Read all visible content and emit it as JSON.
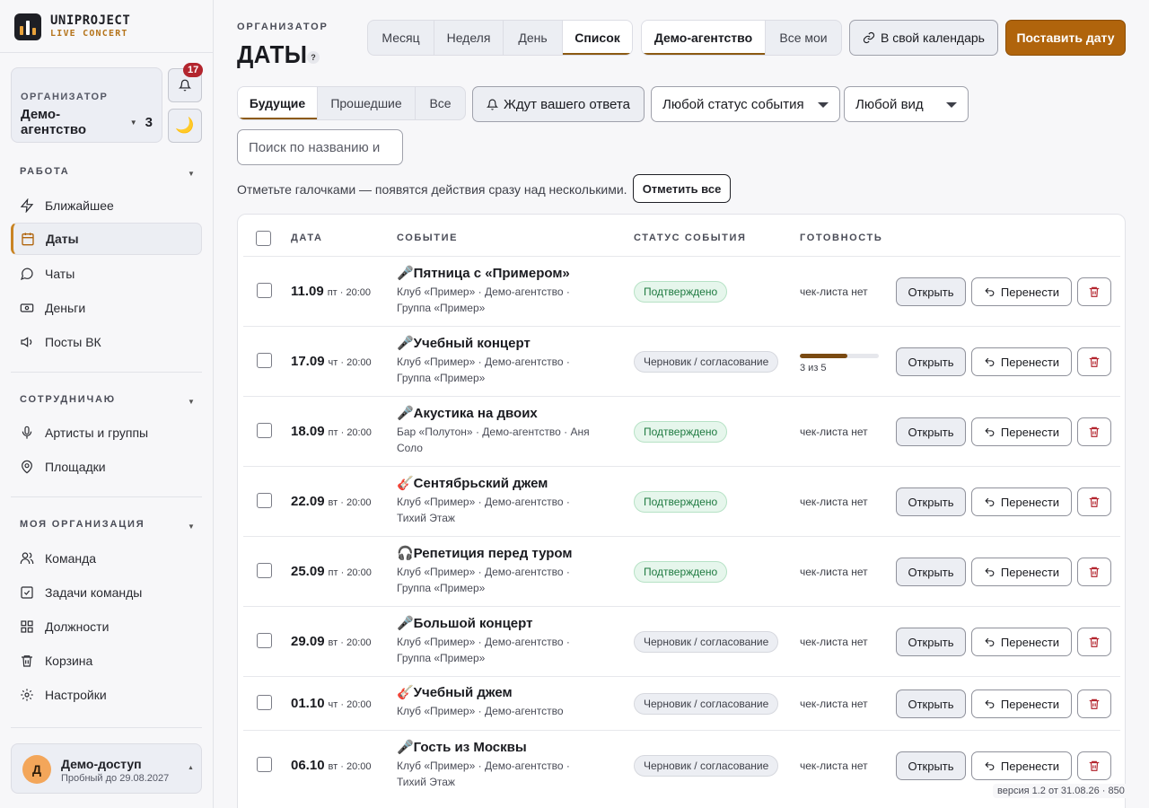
{
  "brand": {
    "name": "UNIPROJECT",
    "sub": "LIVE CONCERT"
  },
  "org": {
    "label": "ОРГАНИЗАТОР",
    "name": "Демо-агентство",
    "count": "3"
  },
  "notifications": {
    "count": "17"
  },
  "sections": {
    "work": "РАБОТА",
    "collab": "СОТРУДНИЧАЮ",
    "myorg": "МОЯ ОРГАНИЗАЦИЯ"
  },
  "nav": {
    "nearest": "Ближайшее",
    "dates": "Даты",
    "chats": "Чаты",
    "money": "Деньги",
    "vk": "Посты ВК",
    "artists": "Артисты и группы",
    "venues": "Площадки",
    "team": "Команда",
    "tasks": "Задачи команды",
    "roles": "Должности",
    "trash": "Корзина",
    "settings": "Настройки"
  },
  "user": {
    "initial": "Д",
    "name": "Демо-доступ",
    "sub": "Пробный до 29.08.2027"
  },
  "page": {
    "pre": "ОРГАНИЗАТОР",
    "title": "ДАТЫ",
    "help": "?"
  },
  "views": [
    "Месяц",
    "Неделя",
    "День",
    "Список"
  ],
  "scope": [
    "Демо-агентство",
    "Все мои"
  ],
  "actions": {
    "calendar": "В свой календарь",
    "add": "Поставить дату"
  },
  "timeframe": [
    "Будущие",
    "Прошедшие",
    "Все"
  ],
  "awaiting": "Ждут вашего ответа",
  "filters": {
    "status": "Любой статус события",
    "kind": "Любой вид"
  },
  "search": {
    "placeholder": "Поиск по названию и"
  },
  "hint": "Отметьте галочками — появятся действия сразу над несколькими.",
  "mark_all": "Отметить все",
  "table": {
    "headers": {
      "date": "ДАТА",
      "event": "СОБЫТИЕ",
      "status": "СТАТУС СОБЫТИЯ",
      "ready": "ГОТОВНОСТЬ"
    },
    "btn_open": "Открыть",
    "btn_move": "Перенести",
    "rows": [
      {
        "date": "11.09",
        "wd": "пт · 20:00",
        "title": "🎤Пятница с «Примером»",
        "sub": "Клуб «Пример» · Демо-агентство · Группа «Пример»",
        "status": "Подтверждено",
        "ready": "чек-листа нет"
      },
      {
        "date": "17.09",
        "wd": "чт · 20:00",
        "title": "🎤Учебный концерт",
        "sub": "Клуб «Пример» · Демо-агентство · Группа «Пример»",
        "status": "Черновик / согласование",
        "ready": "3 из 5",
        "progress": 0.6
      },
      {
        "date": "18.09",
        "wd": "пт · 20:00",
        "title": "🎤Акустика на двоих",
        "sub": "Бар «Полутон» · Демо-агентство · Аня Соло",
        "status": "Подтверждено",
        "ready": "чек-листа нет"
      },
      {
        "date": "22.09",
        "wd": "вт · 20:00",
        "title": "🎸Сентябрьский джем",
        "sub": "Клуб «Пример» · Демо-агентство · Тихий Этаж",
        "status": "Подтверждено",
        "ready": "чек-листа нет"
      },
      {
        "date": "25.09",
        "wd": "пт · 20:00",
        "title": "🎧Репетиция перед туром",
        "sub": "Клуб «Пример» · Демо-агентство · Группа «Пример»",
        "status": "Подтверждено",
        "ready": "чек-листа нет"
      },
      {
        "date": "29.09",
        "wd": "вт · 20:00",
        "title": "🎤Большой концерт",
        "sub": "Клуб «Пример» · Демо-агентство · Группа «Пример»",
        "status": "Черновик / согласование",
        "ready": "чек-листа нет"
      },
      {
        "date": "01.10",
        "wd": "чт · 20:00",
        "title": "🎸Учебный джем",
        "sub": "Клуб «Пример» · Демо-агентство",
        "status": "Черновик / согласование",
        "ready": "чек-листа нет"
      },
      {
        "date": "06.10",
        "wd": "вт · 20:00",
        "title": "🎤Гость из Москвы",
        "sub": "Клуб «Пример» · Демо-агентство · Тихий Этаж",
        "status": "Черновик / согласование",
        "ready": "чек-листа нет"
      }
    ]
  },
  "version": "версия 1.2 от 31.08.26 · 850",
  "colors": {
    "accent": "#b0640c",
    "ok": "#1e7a40",
    "badge": "#b3252e"
  }
}
